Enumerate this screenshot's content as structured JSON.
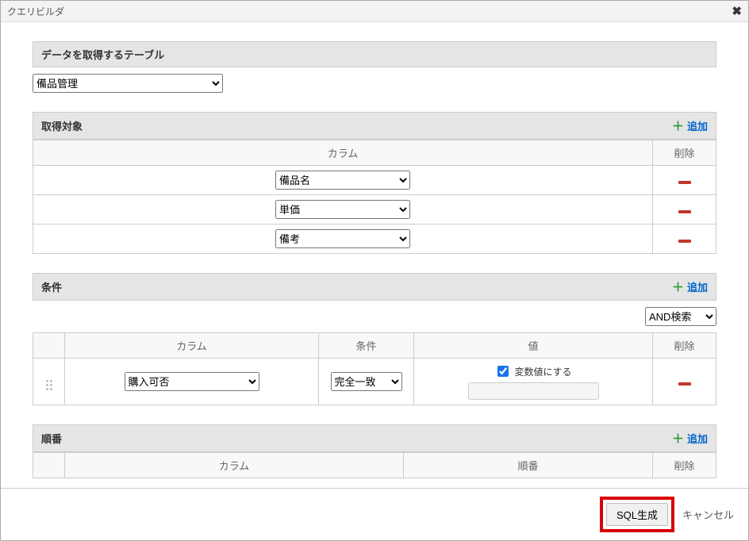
{
  "window": {
    "title": "クエリビルダ"
  },
  "sections": {
    "table": {
      "header": "データを取得するテーブル",
      "selected": "備品管理"
    },
    "target": {
      "header": "取得対象",
      "add_label": "追加",
      "columns_header": "カラム",
      "delete_header": "削除",
      "rows": [
        {
          "column": "備品名"
        },
        {
          "column": "単価"
        },
        {
          "column": "備考"
        }
      ]
    },
    "condition": {
      "header": "条件",
      "add_label": "追加",
      "and_selected": "AND検索",
      "col_header": "カラム",
      "cond_header": "条件",
      "value_header": "値",
      "delete_header": "削除",
      "rows": [
        {
          "column": "購入可否",
          "condition": "完全一致",
          "variable_label": "変数値にする",
          "variable_checked": true
        }
      ]
    },
    "order": {
      "header": "順番",
      "add_label": "追加",
      "col_header": "カラム",
      "order_header": "順番",
      "delete_header": "削除"
    }
  },
  "footer": {
    "generate": "SQL生成",
    "cancel": "キャンセル"
  }
}
